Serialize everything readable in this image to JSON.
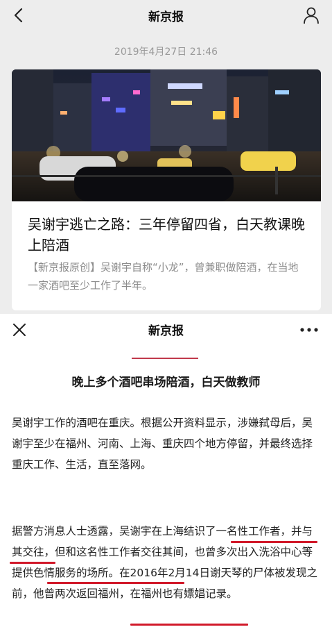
{
  "top_screen": {
    "header_title": "新京报",
    "timestamp": "2019年4月27日 21:46",
    "card": {
      "headline": "吴谢宇逃亡之路：三年停留四省，白天教课晚上陪酒",
      "summary": "【新京报原创】吴谢宇自称“小龙”，曾兼职做陪酒，在当地一家酒吧至少工作了半年。"
    },
    "icons": {
      "back": "chevron-left-icon",
      "profile": "user-icon"
    }
  },
  "bottom_screen": {
    "header_title": "新京报",
    "section_heading": "晚上多个酒吧串场陪酒，白天做教师",
    "paragraph1": "吴谢宇工作的酒吧在重庆。根据公开资料显示，涉嫌弑母后，吴谢宇至少在福州、河南、上海、重庆四个地方停留，并最终选择重庆工作、生活，直至落网。",
    "paragraph2": "据警方消息人士透露，吴谢宇在上海结识了一名性工作者，并与其交往，但和这名性工作者交往其间，也曾多次出入洗浴中心等提供色情服务的场所。在2016年2月14日谢天琴的尸体被发现之前，他曾两次返回福州，在福州也有嫖娼记录。",
    "icons": {
      "close": "close-icon",
      "more": "more-icon"
    },
    "accent_color": "#d1192a"
  }
}
